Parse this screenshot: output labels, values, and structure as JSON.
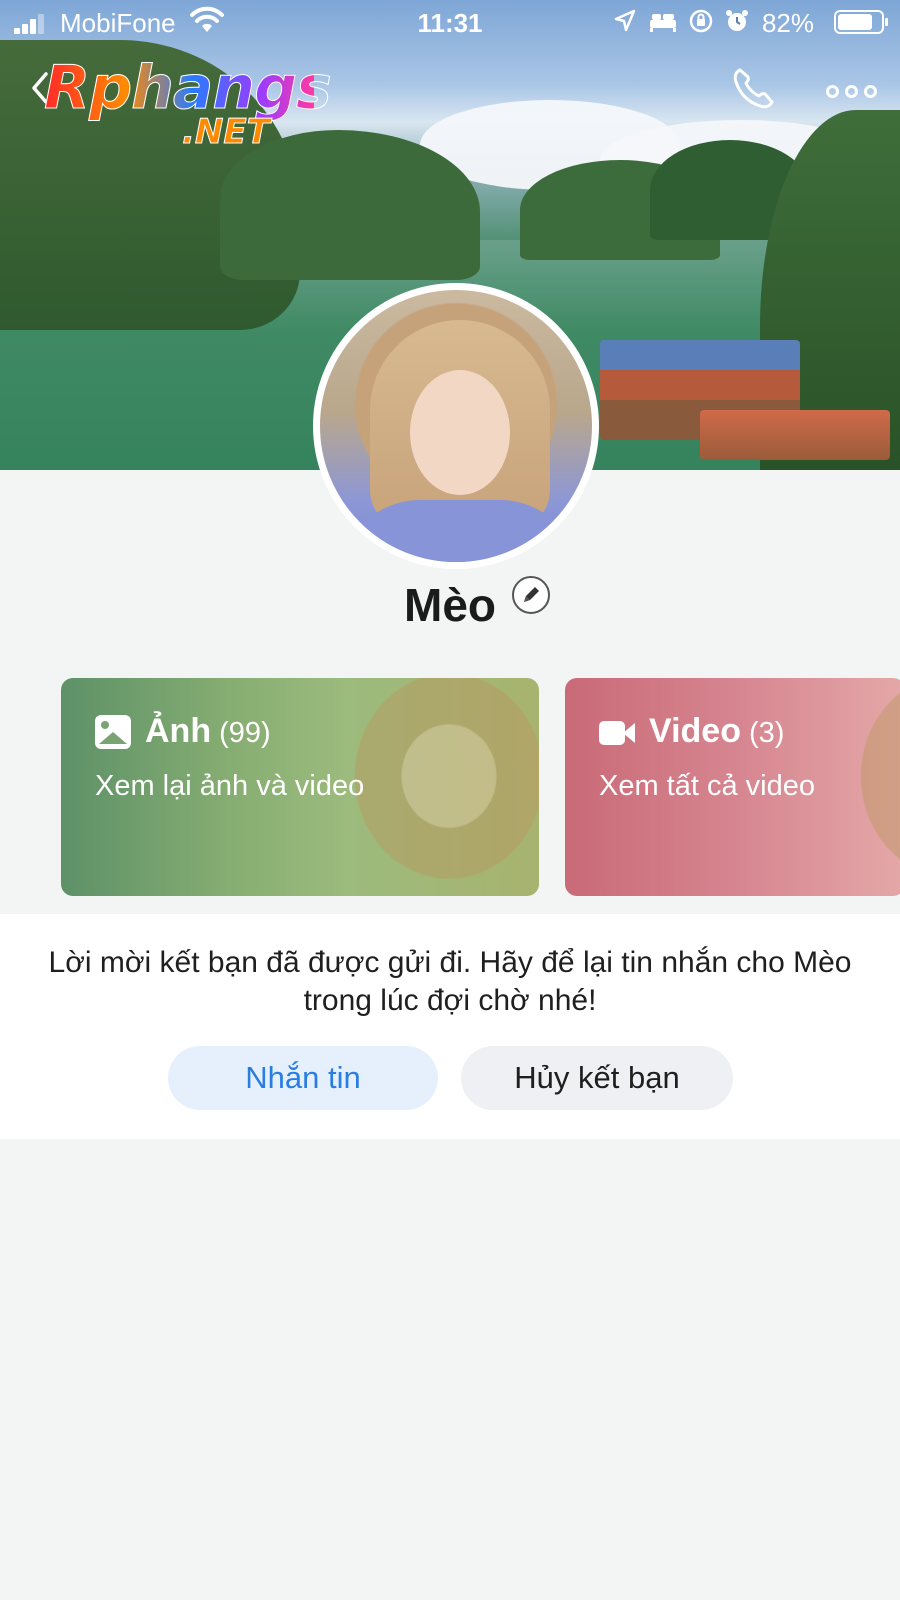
{
  "status_bar": {
    "carrier": "MobiFone",
    "time": "11:31",
    "battery_percent": "82%",
    "battery_level": 0.82,
    "icons": [
      "location-arrow-icon",
      "bed-icon",
      "rotation-lock-icon",
      "alarm-icon"
    ]
  },
  "header": {
    "logo_line1": "Rphangs",
    "logo_line2": ".NET",
    "back_icon": "chevron-left-icon",
    "call_icon": "phone-icon",
    "more_icon": "more-dots-icon"
  },
  "profile": {
    "name": "Mèo",
    "edit_icon": "pencil-icon"
  },
  "cards": {
    "photos": {
      "title": "Ảnh",
      "count": "(99)",
      "subtitle": "Xem lại ảnh và video",
      "icon": "image-icon"
    },
    "videos": {
      "title": "Video",
      "count": "(3)",
      "subtitle": "Xem tất cả video",
      "icon": "video-camera-icon"
    }
  },
  "friend_request": {
    "message": "Lời mời kết bạn đã được gửi đi. Hãy để lại tin nhắn cho Mèo trong lúc đợi chờ nhé!",
    "message_button": "Nhắn tin",
    "cancel_button": "Hủy kết bạn"
  },
  "colors": {
    "accent": "#2a7de1",
    "photo_card": "#86ad72",
    "video_card": "#d68590"
  }
}
